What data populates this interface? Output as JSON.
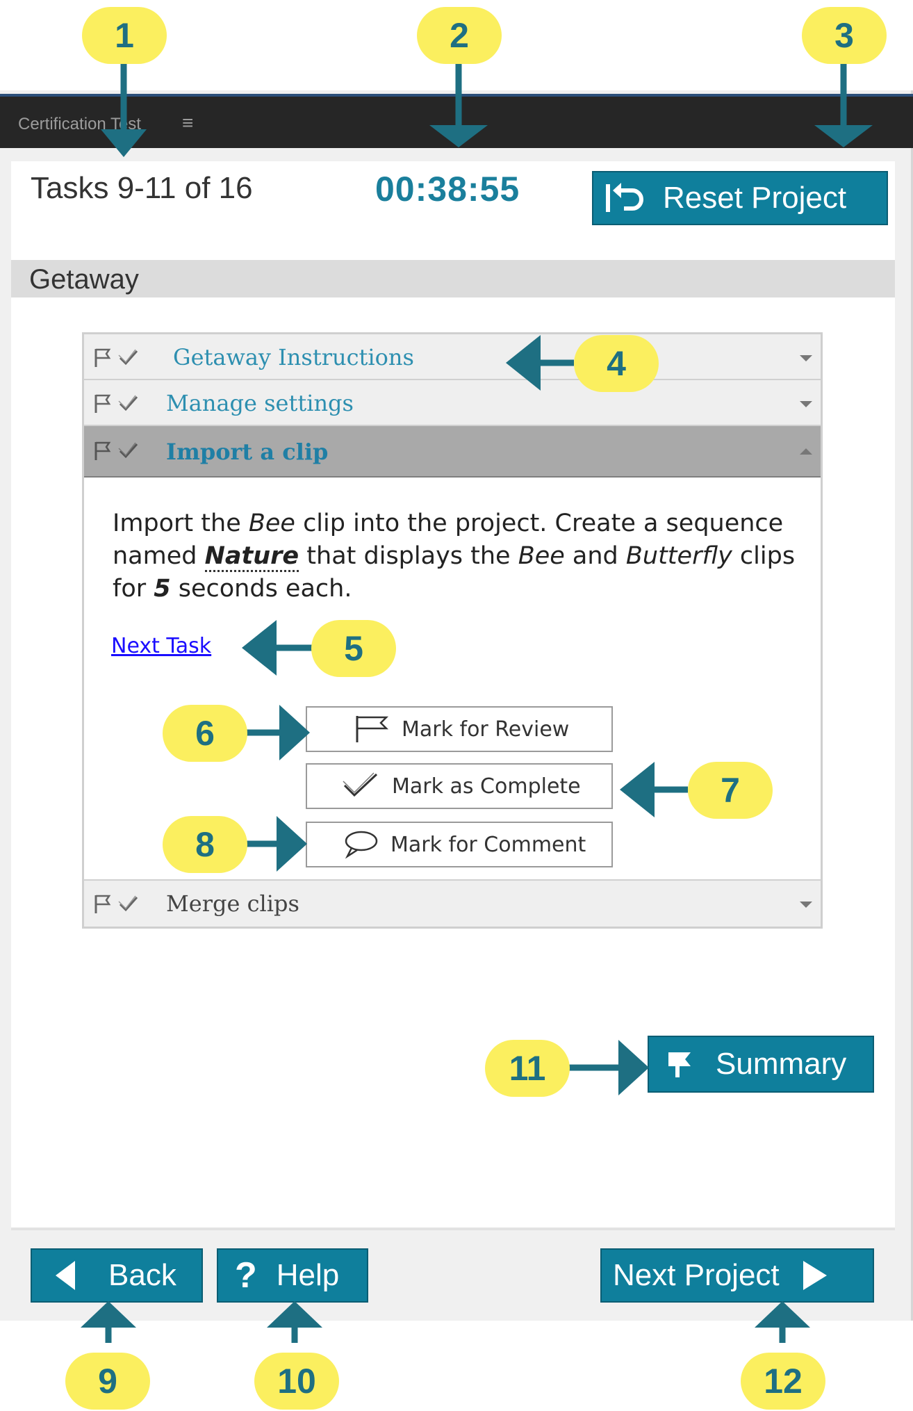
{
  "markers": [
    "1",
    "2",
    "3",
    "4",
    "5",
    "6",
    "7",
    "8",
    "9",
    "10",
    "11",
    "12"
  ],
  "window": {
    "title": "Certification Test",
    "menu_icon": "hamburger-icon"
  },
  "header": {
    "tasks_counter": "Tasks 9-11 of 16",
    "timer": "00:38:55",
    "reset_label": "Reset Project"
  },
  "project": {
    "name": "Getaway"
  },
  "tasks": [
    {
      "label": "Getaway Instructions",
      "expanded": false
    },
    {
      "label": "Manage settings",
      "expanded": false
    },
    {
      "label": "Import a clip",
      "expanded": true
    },
    {
      "label": "Merge clips",
      "expanded": false
    }
  ],
  "task_body": {
    "part1": "Import the ",
    "bee1": "Bee",
    "part2": " clip into the project. Create a sequence named ",
    "nature": "Nature",
    "part3": " that displays the ",
    "bee2": "Bee",
    "part4": " and ",
    "butterfly": "Butterfly",
    "part5": " clips for ",
    "five": "5",
    "part6": " seconds each.",
    "next_task_link": "Next Task"
  },
  "mark_buttons": {
    "review": "Mark for Review",
    "complete": "Mark as Complete",
    "comment": "Mark for Comment"
  },
  "footer": {
    "summary_label": "Summary",
    "back_label": "Back",
    "help_label": "Help",
    "next_project_label": "Next Project"
  },
  "colors": {
    "accent": "#0f7f9c",
    "marker_fill": "#fbef5f",
    "marker_text": "#1e6f82",
    "titlebar": "#262626",
    "link": "#1a0dff"
  }
}
